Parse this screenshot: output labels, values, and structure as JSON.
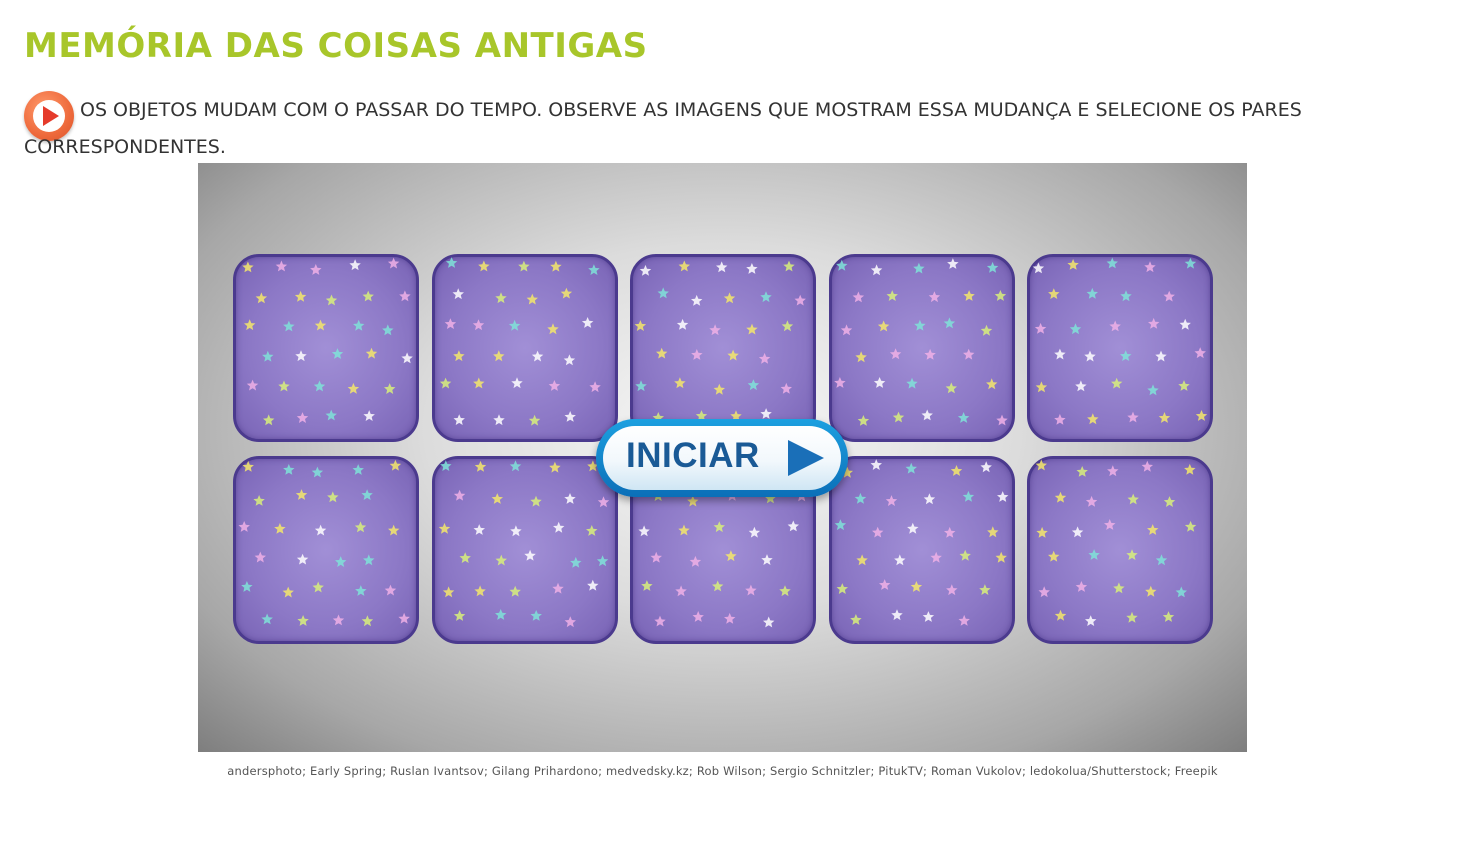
{
  "title": "MEMÓRIA DAS COISAS ANTIGAS",
  "instruction": {
    "text": "OS OBJETOS MUDAM COM O PASSAR DO TEMPO. OBSERVE AS IMAGENS QUE MOSTRAM ESSA MUDANÇA E SELECIONE OS PARES CORRESPONDENTES.",
    "audio_icon": "play-icon"
  },
  "game": {
    "card_back": "star-pattern",
    "rows": 2,
    "columns": 5,
    "start_button_label": "INICIAR",
    "start_icon": "play-triangle-icon"
  },
  "credits": "andersphoto; Early Spring; Ruslan Ivantsov; Gilang Prihardono; medvedsky.kz; Rob Wilson; Sergio Schnitzler; PitukTV; Roman Vukolov; ledokolua/Shutterstock; Freepik",
  "colors": {
    "title": "#a8c62a",
    "card_fill": "#8c78c6",
    "card_border": "#4b3a8e",
    "button_blue": "#1a5a96",
    "audio_orange": "#ee6a3c"
  }
}
